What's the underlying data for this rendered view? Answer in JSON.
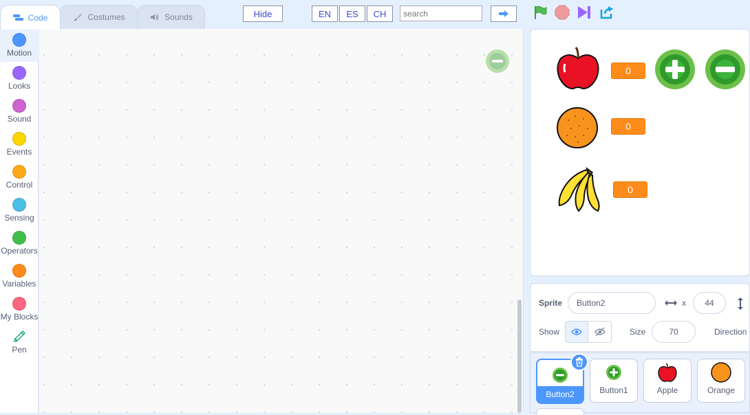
{
  "tabs": [
    {
      "label": "Code",
      "icon": "code-icon"
    },
    {
      "label": "Costumes",
      "icon": "brush-icon"
    },
    {
      "label": "Sounds",
      "icon": "speaker-icon"
    }
  ],
  "toolbar": {
    "hide_label": "Hide",
    "lang_en": "EN",
    "lang_es": "ES",
    "lang_ch": "CH",
    "search_placeholder": "search",
    "go_icon": "arrow-right-icon",
    "controls": [
      "green-flag-icon",
      "stop-icon",
      "step-icon",
      "share-icon"
    ]
  },
  "categories": [
    {
      "label": "Motion",
      "color": "#4c97ff"
    },
    {
      "label": "Looks",
      "color": "#9966ff"
    },
    {
      "label": "Sound",
      "color": "#cf63cf"
    },
    {
      "label": "Events",
      "color": "#ffd500"
    },
    {
      "label": "Control",
      "color": "#ffab19"
    },
    {
      "label": "Sensing",
      "color": "#4cbfe6"
    },
    {
      "label": "Operators",
      "color": "#40bf4a"
    },
    {
      "label": "Variables",
      "color": "#ff8c1a"
    },
    {
      "label": "My Blocks",
      "color": "#ff6680"
    },
    {
      "label": "Pen",
      "color": "#0fbd8c"
    }
  ],
  "stage": {
    "apple_score": "0",
    "orange_score": "0",
    "banana_score": "0"
  },
  "sprite_info": {
    "sprite_label": "Sprite",
    "sprite_name": "Button2",
    "x_label": "x",
    "x_value": "44",
    "show_label": "Show",
    "size_label": "Size",
    "size_value": "70",
    "direction_label": "Direction"
  },
  "sprites": [
    {
      "label": "Button2",
      "selected": true
    },
    {
      "label": "Button1",
      "selected": false
    },
    {
      "label": "Apple",
      "selected": false
    },
    {
      "label": "Orange",
      "selected": false
    }
  ]
}
